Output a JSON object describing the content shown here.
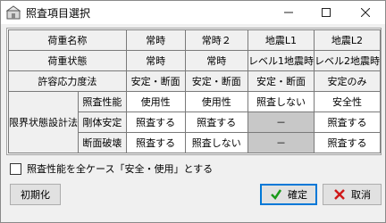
{
  "window": {
    "title": "照査項目選択",
    "title_icon": "app-icon"
  },
  "table": {
    "header_row": [
      "荷重名称",
      "常時",
      "常時２",
      "地震L1",
      "地震L2"
    ],
    "state_row": [
      "荷重状態",
      "常時",
      "常時",
      "レベル1地震時",
      "レベル2地震時"
    ],
    "allowable_row": [
      "許容応力度法",
      "安定・断面",
      "安定・断面",
      "安定・断面",
      "安定のみ"
    ],
    "limit_state_label": "限界状態設計法",
    "limit_rows": [
      {
        "label": "照査性能",
        "values": [
          "使用性",
          "使用性",
          "照査しない",
          "安全性"
        ],
        "disabled": [
          false,
          false,
          false,
          false
        ]
      },
      {
        "label": "剛体安定",
        "values": [
          "照査する",
          "照査する",
          "－",
          "照査する"
        ],
        "disabled": [
          false,
          false,
          true,
          false
        ]
      },
      {
        "label": "断面破壊",
        "values": [
          "照査する",
          "照査しない",
          "－",
          "照査する"
        ],
        "disabled": [
          false,
          false,
          true,
          false
        ]
      }
    ]
  },
  "checkbox_label": "照査性能を全ケース「安全・使用」とする",
  "buttons": {
    "init": "初期化",
    "ok": "確定",
    "cancel": "取消"
  }
}
